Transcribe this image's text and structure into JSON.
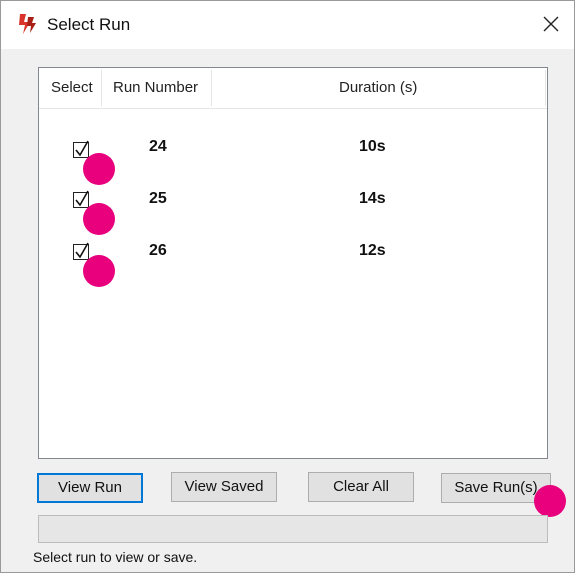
{
  "window": {
    "title": "Select Run",
    "close_glyph": "×"
  },
  "list": {
    "columns": {
      "select": "Select",
      "run_number": "Run Number",
      "duration": "Duration (s)"
    },
    "rows": [
      {
        "checked": true,
        "run_number": "24",
        "duration": "10s"
      },
      {
        "checked": true,
        "run_number": "25",
        "duration": "14s"
      },
      {
        "checked": true,
        "run_number": "26",
        "duration": "12s"
      }
    ]
  },
  "buttons": {
    "view_run": "View Run",
    "view_saved": "View Saved",
    "clear_all": "Clear All",
    "save_runs": "Save Run(s)"
  },
  "status": {
    "text": "Select run to view or save."
  },
  "colors": {
    "marker": "#e8007c",
    "default_button_border": "#0078d7",
    "app_icon": "#d9342b"
  },
  "icons": {
    "app": "app-logo-icon",
    "close": "close-icon",
    "check": "checkmark-icon"
  }
}
